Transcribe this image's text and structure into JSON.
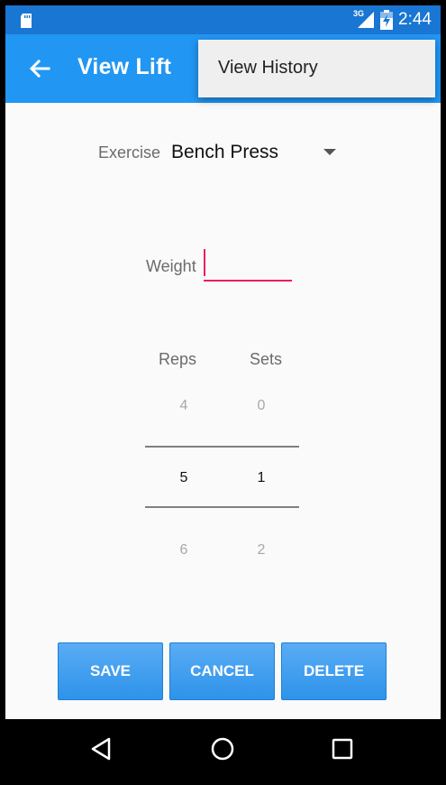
{
  "status_bar": {
    "network": "3G",
    "time": "2:44"
  },
  "app_bar": {
    "title": "View Lift"
  },
  "menu": {
    "items": [
      "View History"
    ]
  },
  "exercise": {
    "label": "Exercise",
    "value": "Bench Press"
  },
  "weight": {
    "label": "Weight",
    "value": ""
  },
  "reps": {
    "label": "Reps",
    "above": "4",
    "selected": "5",
    "below": "6"
  },
  "sets": {
    "label": "Sets",
    "above": "0",
    "selected": "1",
    "below": "2"
  },
  "buttons": {
    "save": "SAVE",
    "cancel": "CANCEL",
    "delete": "DELETE"
  },
  "colors": {
    "status_bar": "#1976d2",
    "app_bar": "#2196f3",
    "accent": "#e91e63",
    "button": "#42a5f5"
  }
}
